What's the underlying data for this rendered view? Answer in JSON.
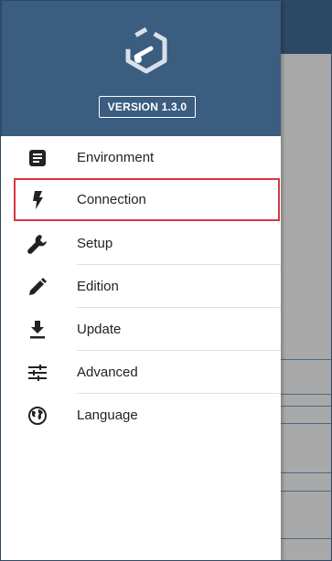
{
  "header": {
    "logo_icon": "hexagon-logo-icon",
    "version_label": "VERSION 1.3.0"
  },
  "menu": {
    "items": [
      {
        "label": "Environment",
        "icon": "document-list-icon",
        "selected": false
      },
      {
        "label": "Connection",
        "icon": "lightning-bolt-icon",
        "selected": true
      },
      {
        "label": "Setup",
        "icon": "wrench-icon",
        "selected": false
      },
      {
        "label": "Edition",
        "icon": "pencil-icon",
        "selected": false
      },
      {
        "label": "Update",
        "icon": "download-icon",
        "selected": false
      },
      {
        "label": "Advanced",
        "icon": "sliders-icon",
        "selected": false
      },
      {
        "label": "Language",
        "icon": "globe-icon",
        "selected": false
      }
    ]
  },
  "colors": {
    "header_bg": "#3a5d80",
    "topbar_bg": "#2d4863",
    "selected_outline": "#d93540",
    "overlay_bg": "#a9a9a9"
  }
}
